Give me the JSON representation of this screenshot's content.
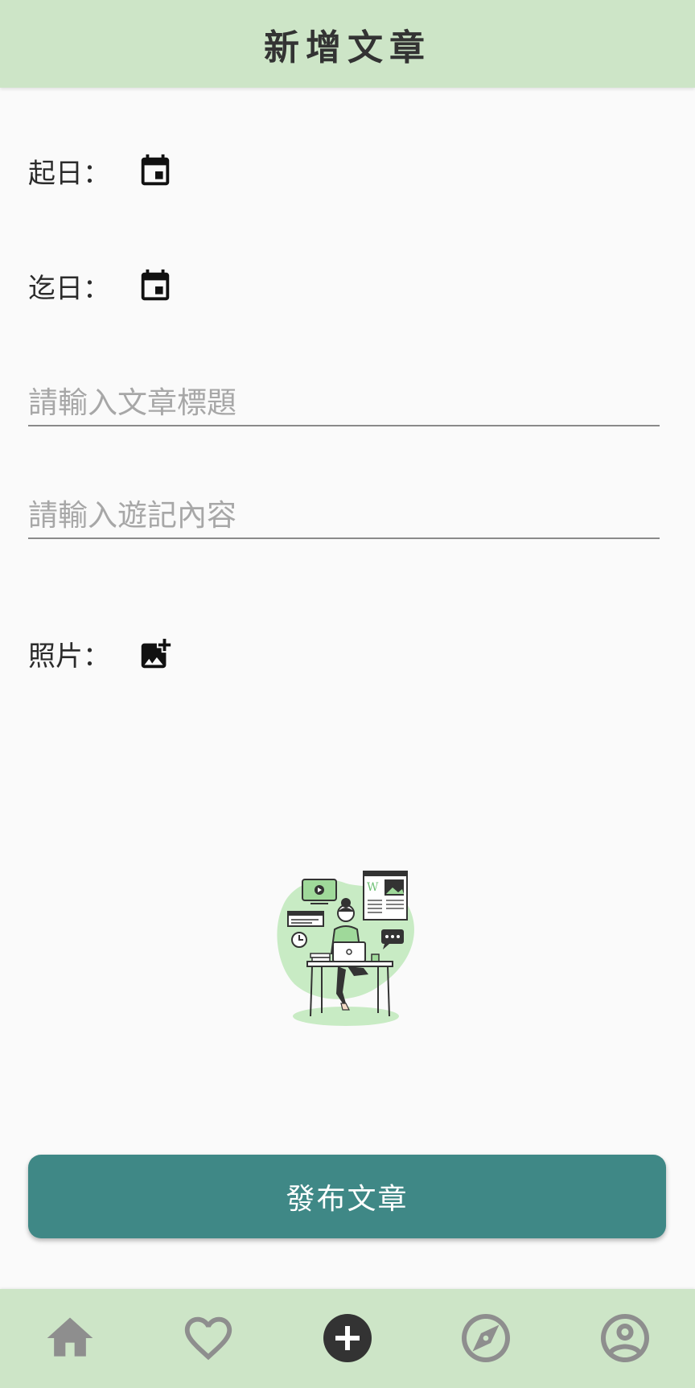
{
  "header": {
    "title": "新增文章"
  },
  "form": {
    "start_date_label": "起日：",
    "end_date_label": "迄日：",
    "title_placeholder": "請輸入文章標題",
    "title_value": "",
    "content_placeholder": "請輸入遊記內容",
    "content_value": "",
    "photo_label": "照片："
  },
  "icons": {
    "start_date": "calendar-icon",
    "end_date": "calendar-icon",
    "photo": "add-photo-icon"
  },
  "actions": {
    "publish_label": "發布文章"
  },
  "bottom_nav": {
    "items": [
      {
        "name": "home",
        "icon": "home-icon",
        "active": false
      },
      {
        "name": "favorites",
        "icon": "heart-icon",
        "active": false
      },
      {
        "name": "add",
        "icon": "plus-circle-icon",
        "active": true
      },
      {
        "name": "explore",
        "icon": "compass-icon",
        "active": false
      },
      {
        "name": "profile",
        "icon": "account-circle-icon",
        "active": false
      }
    ]
  },
  "colors": {
    "header_bg": "#cde5c7",
    "accent": "#3f8886",
    "nav_inactive": "#8e8e8e",
    "nav_active": "#333333",
    "illustration_green": "#c8ebc4"
  }
}
